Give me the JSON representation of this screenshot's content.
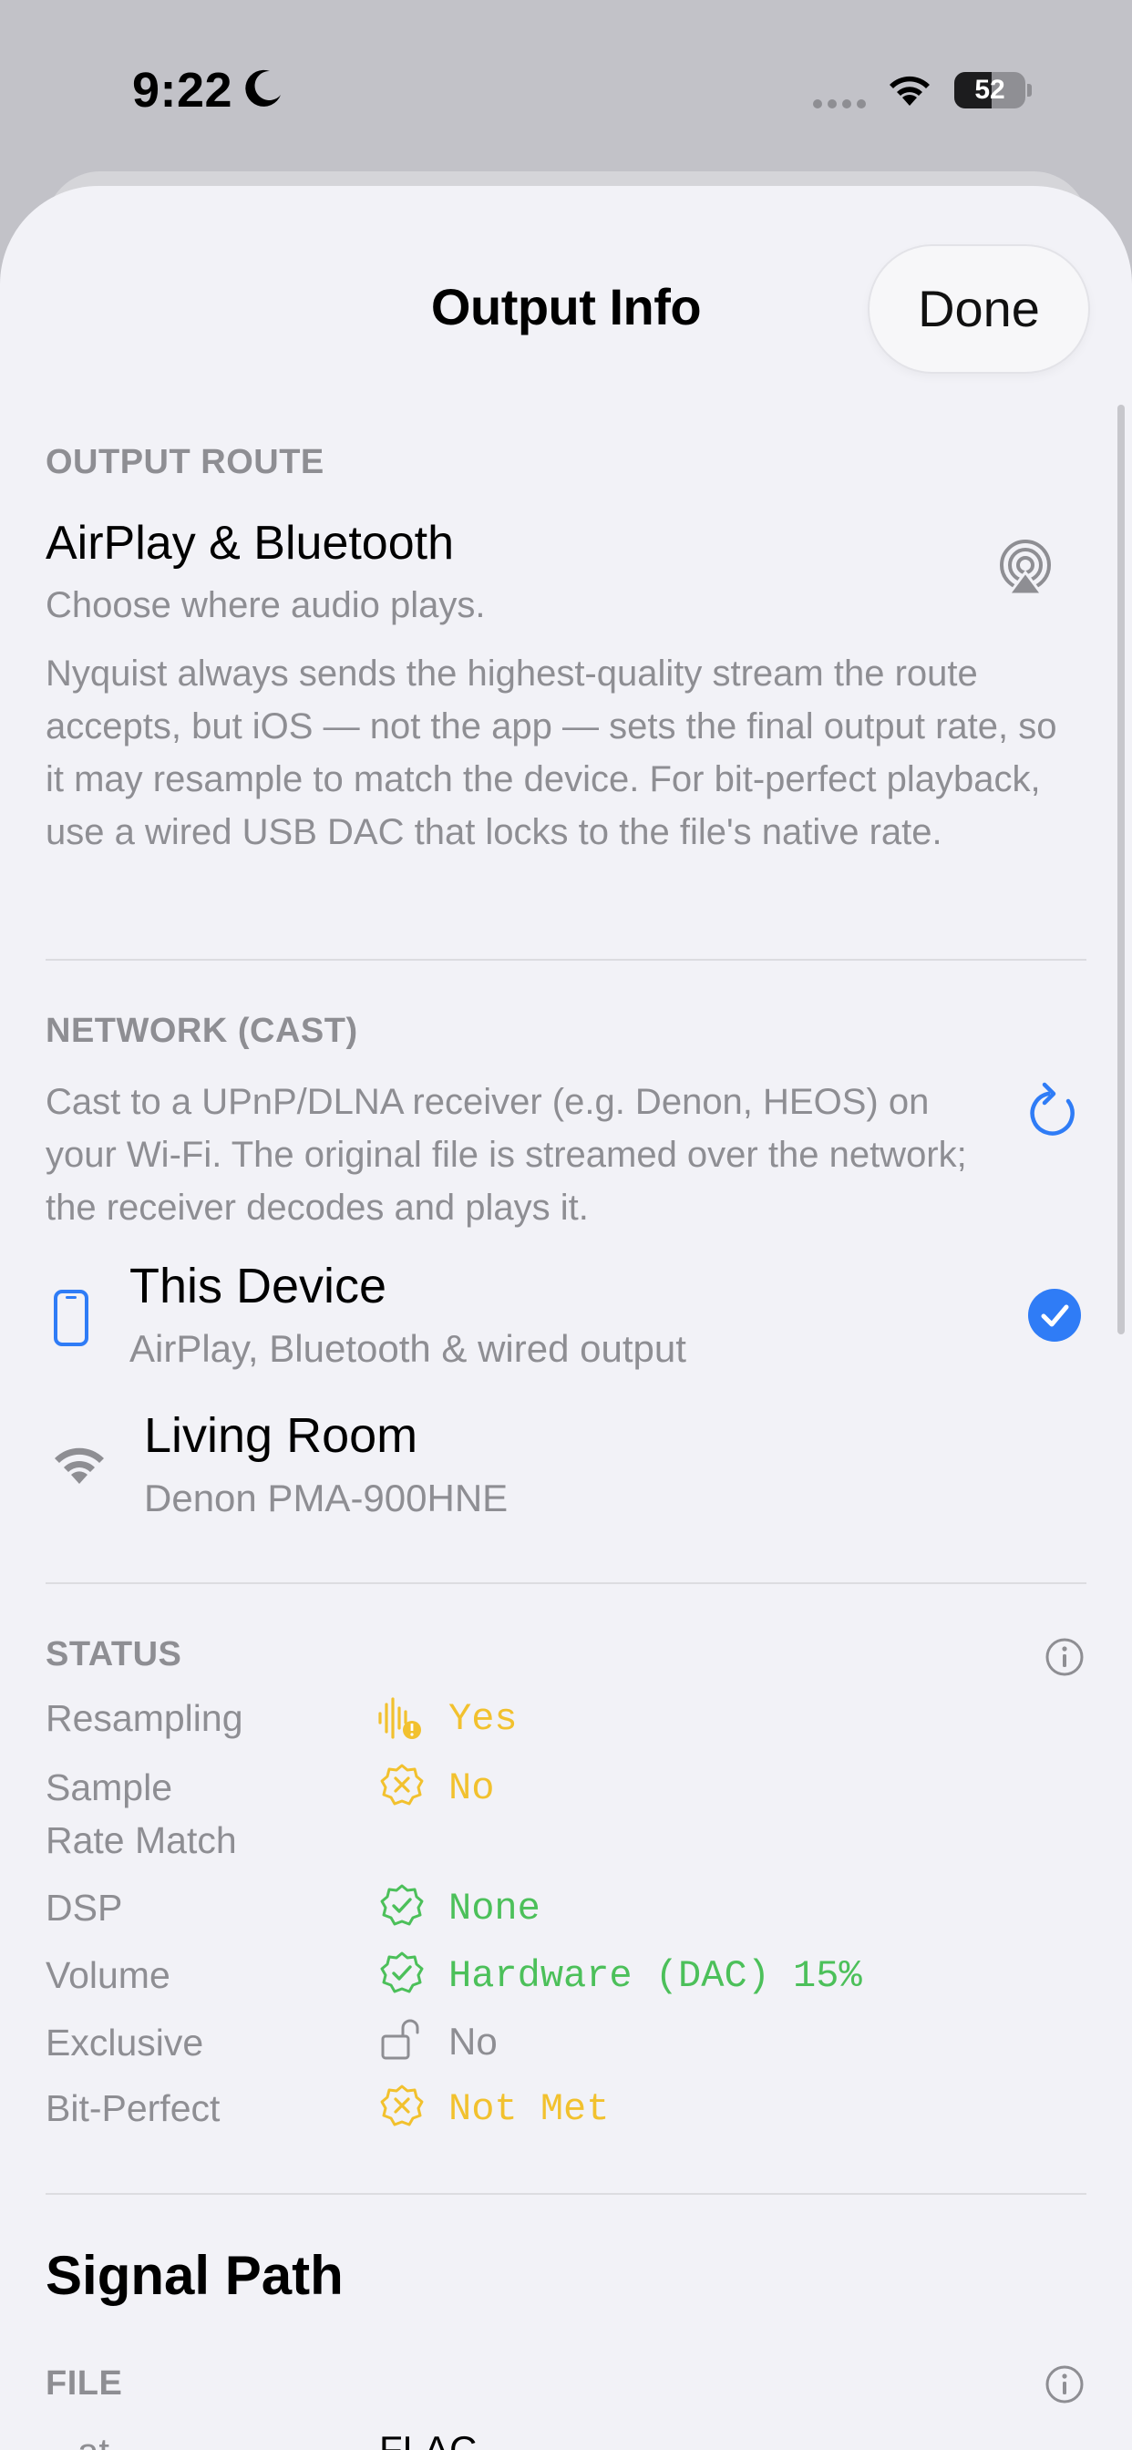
{
  "status_bar": {
    "time": "9:22",
    "battery_level": "52",
    "battery_fraction": 0.52
  },
  "sheet": {
    "title": "Output Info",
    "done_label": "Done"
  },
  "output_route": {
    "header": "OUTPUT ROUTE",
    "title": "AirPlay & Bluetooth",
    "subtitle": "Choose where audio plays.",
    "description": "Nyquist always sends the highest-quality stream the route accepts, but iOS — not the app — sets the final output rate, so it may resample to match the device. For bit-perfect playback, use a wired USB DAC that locks to the file's native rate.",
    "icon": "airplay-icon"
  },
  "network": {
    "header": "NETWORK (CAST)",
    "description": "Cast to a UPnP/DLNA receiver (e.g. Denon, HEOS) on your Wi-Fi. The original file is streamed over the network; the receiver decodes and plays it.",
    "refresh_icon": "refresh-icon",
    "devices": [
      {
        "title": "This Device",
        "subtitle": "AirPlay, Bluetooth & wired output",
        "icon": "phone-icon",
        "selected": true
      },
      {
        "title": "Living Room",
        "subtitle": "Denon PMA-900HNE",
        "icon": "wifi-icon",
        "selected": false
      }
    ]
  },
  "status": {
    "header": "STATUS",
    "info_icon": "info-icon",
    "rows": [
      {
        "label": "Resampling",
        "value": "Yes",
        "color": "#f2c12e",
        "icon": "waveform-warning-icon"
      },
      {
        "label": "Sample\nRate Match",
        "value": "No",
        "color": "#f2c12e",
        "icon": "badge-x-icon"
      },
      {
        "label": "DSP",
        "value": "None",
        "color": "#4cc05a",
        "icon": "badge-check-icon"
      },
      {
        "label": "Volume",
        "value": "Hardware (DAC) 15%",
        "color": "#4cc05a",
        "icon": "badge-check-icon"
      },
      {
        "label": "Exclusive",
        "value": "No",
        "color": "#8e8e93",
        "icon": "unlock-icon"
      },
      {
        "label": "Bit-Perfect",
        "value": "Not Met",
        "color": "#f2c12e",
        "icon": "badge-x-icon"
      }
    ]
  },
  "signal_path": {
    "title": "Signal Path",
    "file_header": "FILE",
    "info_icon": "info-icon",
    "partial_row": {
      "label": "...at",
      "value": "FLAC"
    }
  },
  "colors": {
    "accent": "#2f7cf6",
    "warning": "#f2c12e",
    "success": "#4cc05a",
    "secondary": "#8e8e93"
  }
}
